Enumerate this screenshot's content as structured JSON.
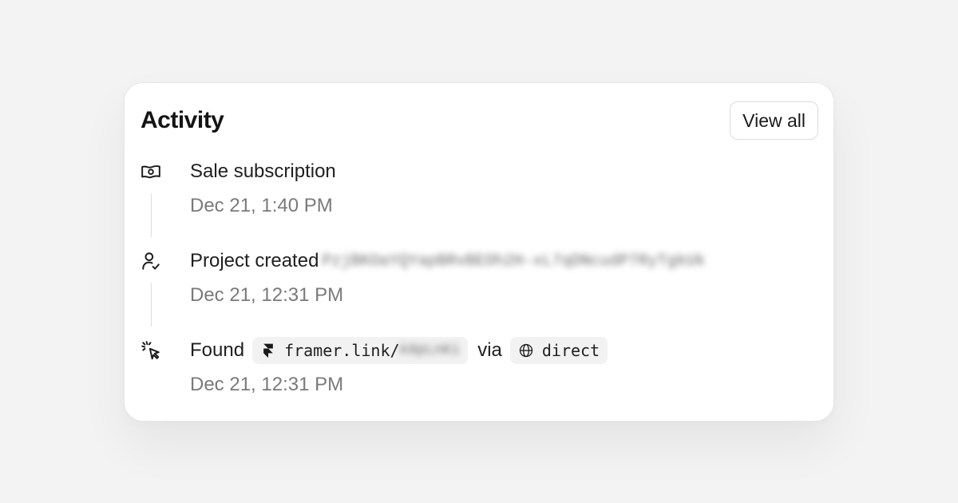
{
  "card": {
    "title": "Activity",
    "view_all_label": "View all"
  },
  "activity": [
    {
      "icon": "money-icon",
      "label": "Sale subscription",
      "time": "Dec 21, 1:40 PM"
    },
    {
      "icon": "user-check-icon",
      "label": "Project created",
      "hidden_text": "PzjBKOaYQYapBRvBEOh2H-xL7qDNcudP7RyTgkUk",
      "time": "Dec 21, 12:31 PM"
    },
    {
      "icon": "cursor-click-icon",
      "label": "Found",
      "link_prefix": "framer.link/",
      "link_hidden": "k8pLnKi",
      "via_label": "via",
      "source_label": "direct",
      "time": "Dec 21, 12:31 PM"
    }
  ]
}
